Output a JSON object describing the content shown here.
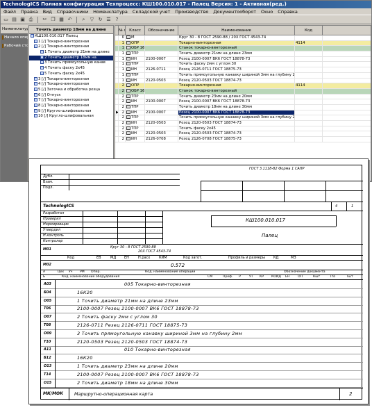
{
  "window": {
    "title": "TechnologICS Полная конфигурация Техпроцесс: КШ100.010.017 - Палец Версия: 1 - Активная(ред.)"
  },
  "menu": [
    "Файл",
    "Правка",
    "Вид",
    "Справочники",
    "Номенклатура",
    "Складской учет",
    "Производство",
    "Документооборот",
    "Окно",
    "Справка"
  ],
  "toolbar_icons": [
    "new-icon",
    "open-icon",
    "save-icon",
    "print-icon",
    "cut-icon",
    "copy-icon",
    "paste-icon",
    "undo-icon",
    "find-icon",
    "filter-icon",
    "refresh-icon",
    "props-icon",
    "help-icon"
  ],
  "nav": {
    "items": [
      "Номенклатура",
      "Начало операции",
      "Рабочий стол"
    ]
  },
  "tree": {
    "header": "Точить диаметр 18мм на длине",
    "rows": [
      "КШ100.010.017 Палец",
      "1 [/] Токарно-винторезная",
      "2 [/] Токарно-винторезная",
      "1 Точить диаметр 21мм на длине",
      "2 Точить диаметр 18мм на",
      "3 Точить прямоугольную канав",
      "4 Точить фаску 2х45",
      "5 Точить фаску 2х45",
      "3 [/] Токарно-винторезная",
      "4 [/] Токарно-винторезная",
      "5 [/] Заточка и обработка резца",
      "6 [/] Отпуск",
      "7 [/] Токарно-винторезная",
      "8 [/] Токарно-винторезная",
      "9 [/] Кругло-шлифовальная",
      "10 [/] Кругло-шлифовальная"
    ],
    "selected_index": 4
  },
  "grid": {
    "headers": [
      "№ стр",
      "Класс",
      "Обозначение",
      "Наименование",
      "Код"
    ],
    "rows": [
      {
        "num": "0",
        "cls": "М",
        "des": "",
        "name": "Круг 30 - 8 ГОСТ 2590-88 / 20Х ГОСТ 4543-74",
        "code": "",
        "type": ""
      },
      {
        "num": "1",
        "cls": "ОПР",
        "des": "",
        "name": "Токарно-винторезная",
        "code": "4114",
        "type": "opr"
      },
      {
        "num": "1",
        "cls": "ОБР 16К20",
        "des": "",
        "name": "Станок токарно-винторезный",
        "code": "",
        "type": "obr"
      },
      {
        "num": "1",
        "cls": "ТПР",
        "des": "",
        "name": "Точить диаметр 21мм на длине 23мм",
        "code": "",
        "type": ""
      },
      {
        "num": "1",
        "cls": "ИН",
        "des": "2100-0007",
        "name": "Резец 2100-0007 ВК6 ГОСТ 18878-73",
        "code": "",
        "type": ""
      },
      {
        "num": "1",
        "cls": "ТПР",
        "des": "",
        "name": "Точить фаску 2мм с углом 30",
        "code": "",
        "type": ""
      },
      {
        "num": "1",
        "cls": "ИН",
        "des": "2126-0711",
        "name": "Резец 2126-0711 ГОСТ 18875-73",
        "code": "",
        "type": ""
      },
      {
        "num": "1",
        "cls": "ТПР",
        "des": "",
        "name": "Точить прямоугольную канавку шириной 3мм на глубину 2мм",
        "code": "",
        "type": ""
      },
      {
        "num": "1",
        "cls": "ИН",
        "des": "2120-0503",
        "name": "Резец 2120-0503 ГОСТ 18874-73",
        "code": "",
        "type": ""
      },
      {
        "num": "2",
        "cls": "ОПР",
        "des": "",
        "name": "Токарно-винторезная",
        "code": "4114",
        "type": "opr"
      },
      {
        "num": "2",
        "cls": "ОБР 16К20",
        "des": "",
        "name": "Станок токарно-винторезный",
        "code": "",
        "type": "obr"
      },
      {
        "num": "2",
        "cls": "ТПР",
        "des": "",
        "name": "Точить диаметр 23мм на длине 20мм",
        "code": "",
        "type": ""
      },
      {
        "num": "2",
        "cls": "ИН",
        "des": "2100-0007",
        "name": "Резец 2100-0007 ВК6 ГОСТ 18878-73",
        "code": "",
        "type": ""
      },
      {
        "num": "2",
        "cls": "ТПР",
        "des": "",
        "name": "Точить диаметр 18мм на длине 30мм",
        "code": "",
        "type": ""
      },
      {
        "num": "2",
        "cls": "ИН",
        "des": "2100-0007",
        "name": "Резец 2100-0007 ВК6 ГОСТ 18878-73",
        "code": "",
        "type": "sel"
      },
      {
        "num": "2",
        "cls": "ТПР",
        "des": "",
        "name": "Точить прямоугольную канавку шириной 3мм на глубину 2мм",
        "code": "",
        "type": ""
      },
      {
        "num": "2",
        "cls": "ИН",
        "des": "2120-0503",
        "name": "Резец 2120-0503 ГОСТ 18874-73",
        "code": "",
        "type": ""
      },
      {
        "num": "2",
        "cls": "ТПР",
        "des": "",
        "name": "Точить фаску 2х45",
        "code": "",
        "type": ""
      },
      {
        "num": "2",
        "cls": "ИН",
        "des": "2120-0503",
        "name": "Резец 2120-0503 ГОСТ 18874-73",
        "code": "",
        "type": ""
      },
      {
        "num": "2",
        "cls": "ИН",
        "des": "2126-0708",
        "name": "Резец 2126-0708 ГОСТ 18875-73",
        "code": "",
        "type": ""
      }
    ]
  },
  "doc": {
    "form_ref": "ГОСТ 3.1118-82 Форма 1 САПР",
    "dubl": "Дубл.",
    "vzam": "Взам.",
    "podl": "Подл.",
    "company": "TechnologICS",
    "sheet_total": "4",
    "sheet_num": "1",
    "roles": [
      "Разработал",
      "Проверил",
      "Нормировщик",
      "Утвердил",
      "Н.контроль",
      "Контролер"
    ],
    "part_code": "КШ100.010.017",
    "part_name": "Палец",
    "m01_label": "М01",
    "material_line1": "Круг     30 - 8 ГОСТ 2590-88",
    "material_line2": "20Х ГОСТ 4543-74",
    "m02_label": "М02",
    "material_headers": [
      "Код",
      "ЕВ",
      "МД",
      "ЕН",
      "Н.расх",
      "КИМ",
      "Код загот.",
      "Профиль и размеры",
      "КД",
      "МЗ"
    ],
    "mass": "0.572",
    "col_headers_a": [
      "А",
      "Цех",
      "Уч",
      "РМ",
      "Опер.",
      "Код, наименование операции",
      "Обозначение документа"
    ],
    "col_headers_b": [
      "Б",
      "Код, наименование оборудования",
      "СМ",
      "Проф.",
      "Р",
      "УТ",
      "КР",
      "КОИД",
      "ЕН",
      "ОП",
      "Кшт",
      "Тпз",
      "Тшт"
    ],
    "lines": [
      {
        "code": "А03",
        "text": "005     Токарно-винторезная",
        "centered": true
      },
      {
        "code": "Б04",
        "text": "16К20",
        "centered": false
      },
      {
        "code": "О05",
        "text": "1     Точить диаметр 21мм на длине 23мм",
        "centered": false
      },
      {
        "code": "Т06",
        "text": "2100-0007  Резец 2100-0007 ВК6 ГОСТ 18878-73",
        "centered": false
      },
      {
        "code": "О07",
        "text": "2     Точить фаску 2мм с углом 30",
        "centered": false
      },
      {
        "code": "Т08",
        "text": "2126-0711  Резец 2126-0711 ГОСТ 18875-73",
        "centered": false
      },
      {
        "code": "О09",
        "text": "3     Точить  прямоугольную канавку шириной 3мм на глубину 2мм",
        "centered": false
      },
      {
        "code": "Т10",
        "text": "2120-0503  Резец 2120-0503 ГОСТ 18874-73",
        "centered": false
      },
      {
        "code": "А11",
        "text": "010     Токарно-винторезная",
        "centered": true
      },
      {
        "code": "Б12",
        "text": "16К20",
        "centered": false
      },
      {
        "code": "О13",
        "text": "1     Точить диаметр 23мм на длине 20мм",
        "centered": false
      },
      {
        "code": "Т14",
        "text": "2100-0007  Резец 2100-0007 ВК6 ГОСТ 18878-73",
        "centered": false
      },
      {
        "code": "О15",
        "text": "2     Точить диаметр 18мм на длине 30мм",
        "centered": false
      }
    ],
    "footer_label": "МК/МОК",
    "footer_title": "Маршрутно-операционная карта",
    "footer_page": "2"
  }
}
